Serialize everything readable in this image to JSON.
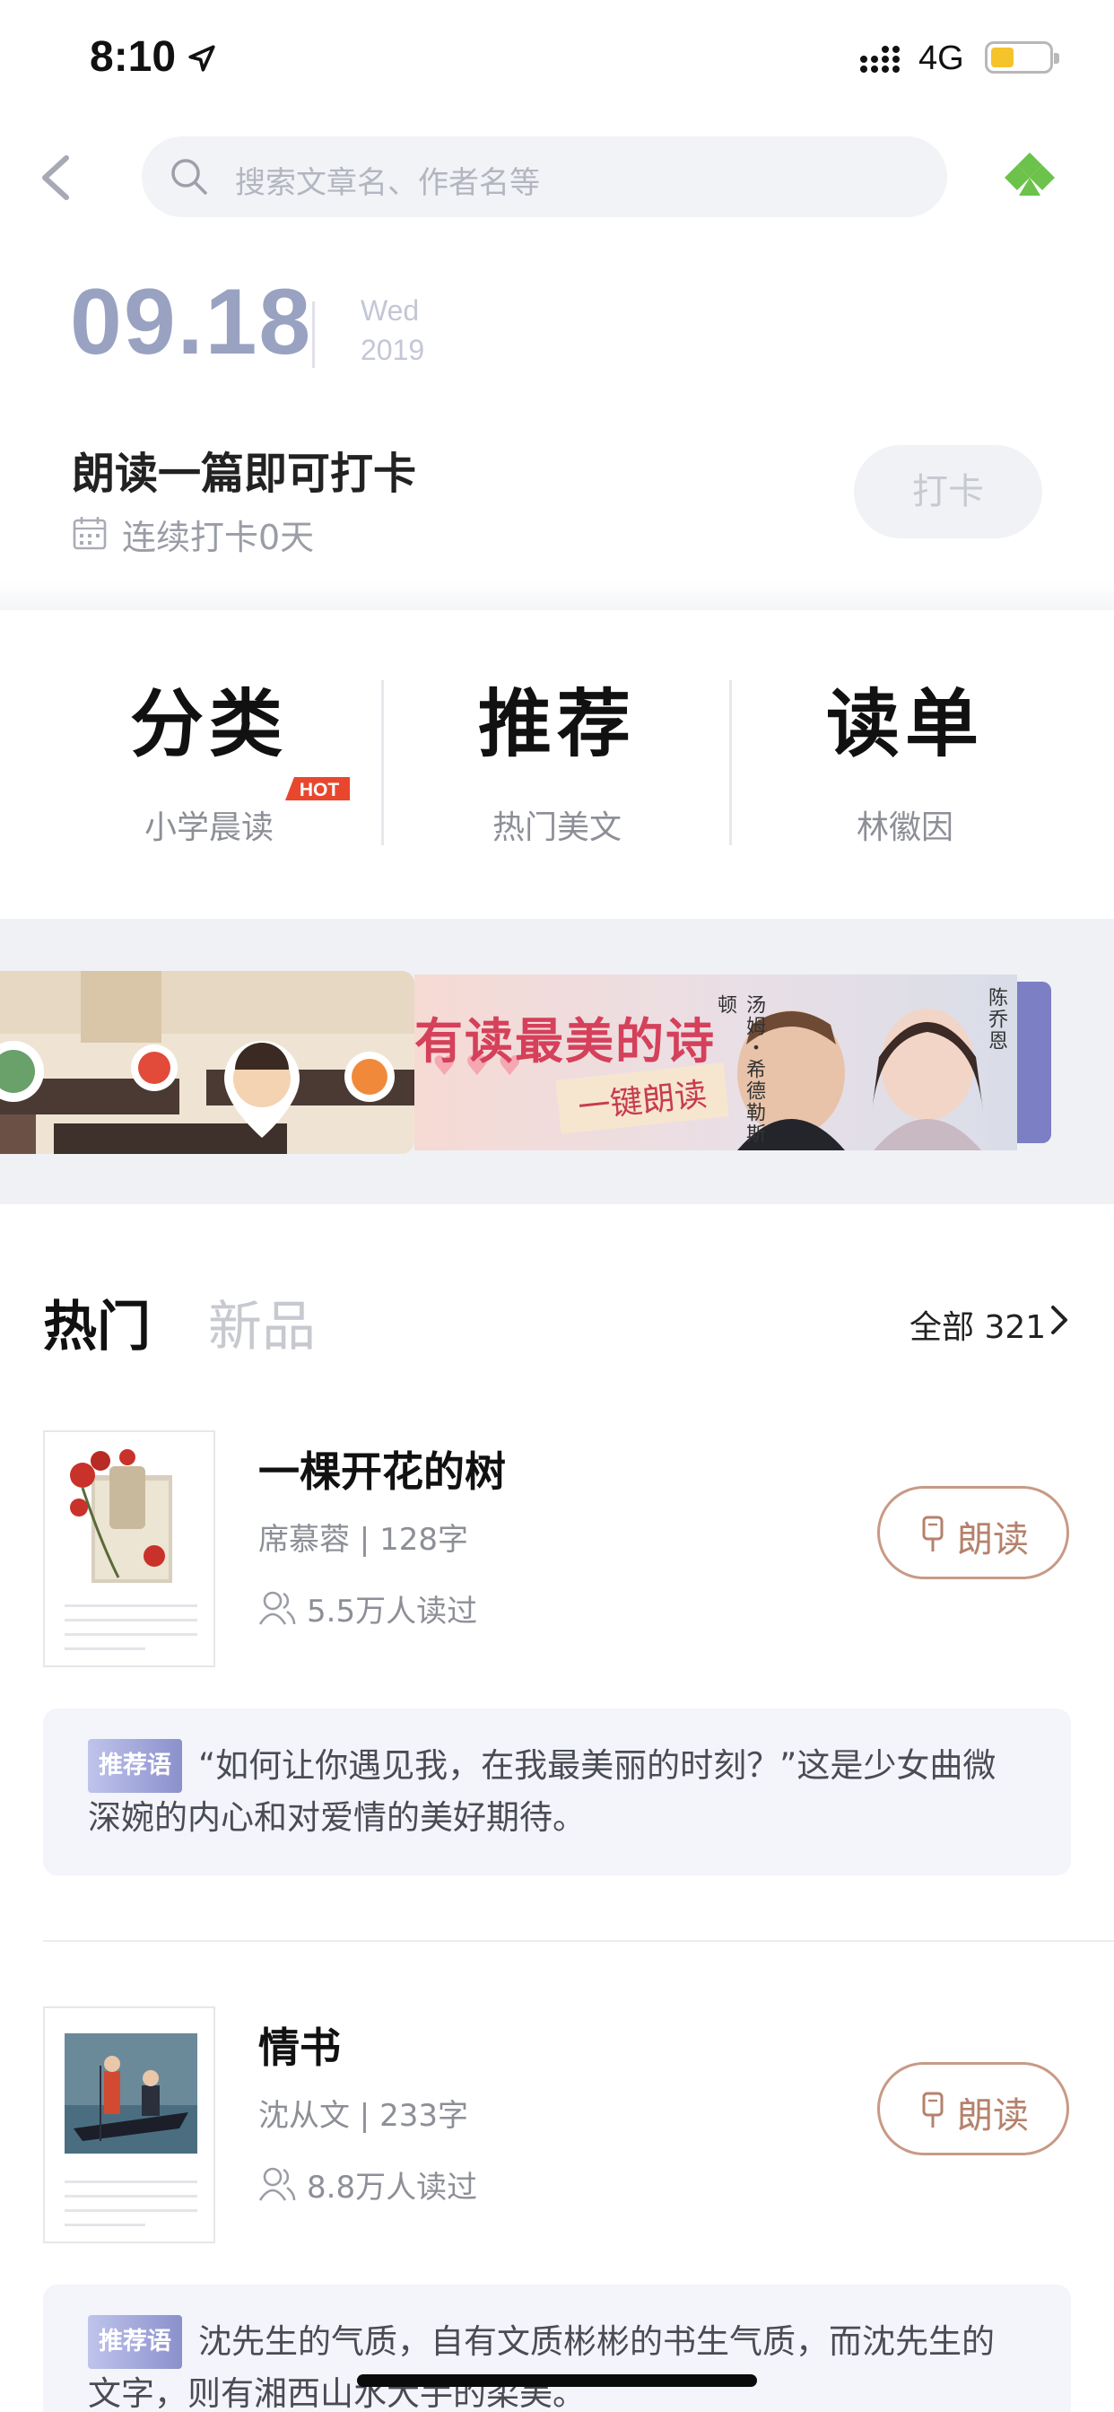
{
  "status_bar": {
    "time": "8:10",
    "network": "4G",
    "battery_level": 0.4
  },
  "search": {
    "placeholder": "搜索文章名、作者名等"
  },
  "date": {
    "day": "09.18",
    "weekday": "Wed",
    "year": "2019"
  },
  "checkin": {
    "title": "朗读一篇即可打卡",
    "streak": "连续打卡0天",
    "button": "打卡"
  },
  "categories": [
    {
      "title": "分类",
      "subtitle": "小学晨读",
      "badge": "HOT"
    },
    {
      "title": "推荐",
      "subtitle": "热门美文"
    },
    {
      "title": "读单",
      "subtitle": "林徽因"
    }
  ],
  "banner": {
    "headline": "有读最美的诗",
    "button": "一键朗读",
    "cast": [
      "汤姆・希德勒斯顿",
      "陈乔恩"
    ],
    "accent": "#d5405a"
  },
  "tabs": {
    "hot": "热门",
    "new": "新品",
    "all_label": "全部 321"
  },
  "articles": [
    {
      "title": "一棵开花的树",
      "meta": "席慕蓉 | 128字",
      "reads": "5.5万人读过",
      "button": "朗读",
      "rec_tag": "推荐语",
      "rec_text": "“如何让你遇见我，在我最美丽的时刻？”这是少女曲微深婉的内心和对爱情的美好期待。"
    },
    {
      "title": "情书",
      "meta": "沈从文 | 233字",
      "reads": "8.8万人读过",
      "button": "朗读",
      "rec_tag": "推荐语",
      "rec_text": "沈先生的气质，自有文质彬彬的书生气质，而沈先生的文字，则有湘西山水大手的柔美。"
    }
  ],
  "colors": {
    "brand_green": "#6cc24a",
    "date_color": "#9aa2c2",
    "read_button": "#c89a86",
    "rec_bg": "#f4f4fb"
  },
  "icons": [
    "back-chevron-icon",
    "search-icon",
    "clover-icon",
    "calendar-icon",
    "chevron-right-icon",
    "people-icon",
    "microphone-icon"
  ]
}
